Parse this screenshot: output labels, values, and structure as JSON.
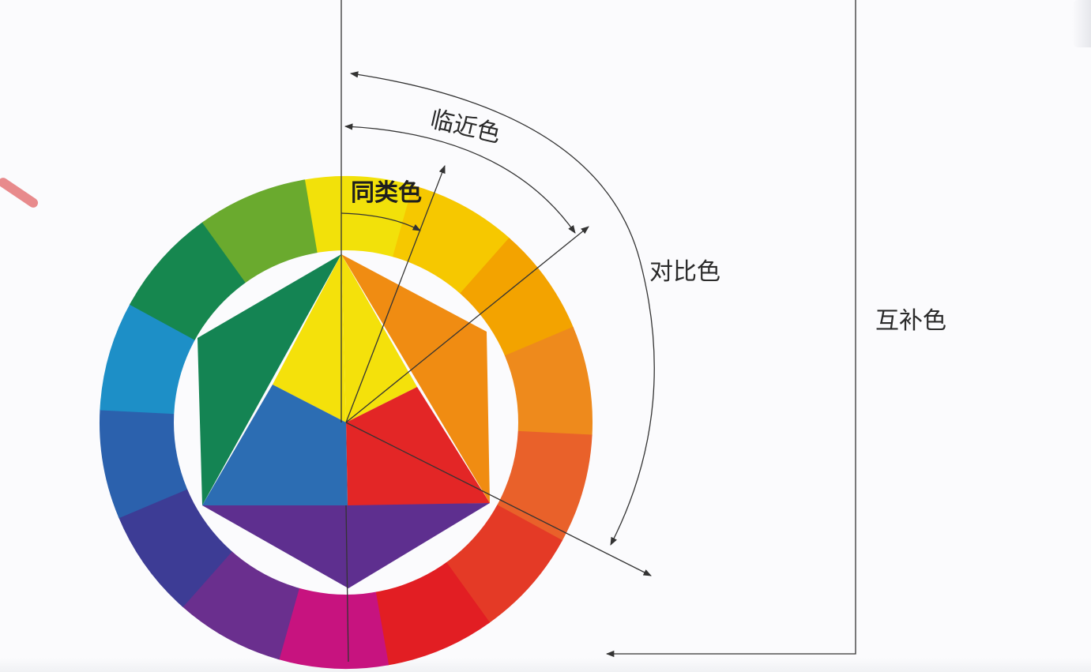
{
  "labels": {
    "analogous_similar": "同类色",
    "adjacent": "临近色",
    "contrast": "对比色",
    "complementary": "互补色"
  },
  "wheel": {
    "outer_ring_colors": [
      "#f2e10a",
      "#f6c800",
      "#f3a300",
      "#ee8a1c",
      "#e9612a",
      "#e43a26",
      "#e21e23",
      "#c7137f",
      "#6a2f8e",
      "#3d3c95",
      "#2b61ad",
      "#1d8fc7",
      "#16874f",
      "#6aaa2e"
    ],
    "inner_triangle_colors": {
      "yellow": "#f4e10b",
      "orange": "#f08c12",
      "red": "#e32626",
      "purple": "#5e2f8f",
      "blue": "#2c6db3",
      "green": "#148453"
    }
  }
}
